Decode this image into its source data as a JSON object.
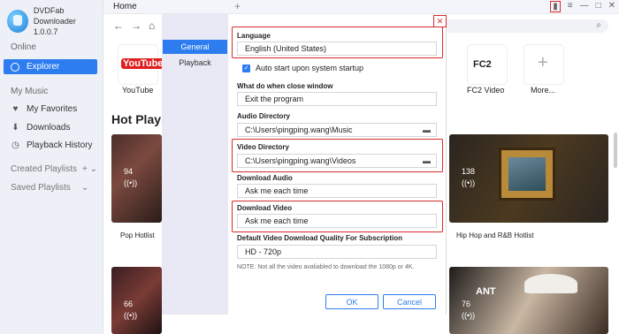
{
  "app": {
    "name": "DVDFab Downloader",
    "version": "1.0.0.7"
  },
  "sidebar": {
    "online_header": "Online",
    "explorer": "Explorer",
    "mymusic_header": "My Music",
    "items": [
      {
        "label": "My Favorites",
        "icon": "heart-icon"
      },
      {
        "label": "Downloads",
        "icon": "download-icon"
      },
      {
        "label": "Playback History",
        "icon": "history-icon"
      }
    ],
    "created_playlists": "Created Playlists",
    "saved_playlists": "Saved Playlists"
  },
  "tabs": {
    "home": "Home"
  },
  "sites": {
    "youtube_logo": "YouTube",
    "youtube": "YouTube",
    "fc2_logo": "FC2",
    "fc2": "FC2 Video",
    "more": "More..."
  },
  "hot_title": "Hot Playlis",
  "cards": [
    {
      "count": "94",
      "title": "Pop Hotlist"
    },
    {
      "count": "138",
      "title": "Hip Hop and R&B Hotlist"
    },
    {
      "count": "66"
    },
    {
      "count": "76",
      "overlay_text": "ANT"
    }
  ],
  "dialog": {
    "nav": {
      "general": "General",
      "playback": "Playback"
    },
    "language_label": "Language",
    "language_value": "English (United States)",
    "auto_start": "Auto start upon system startup",
    "close_label": "What do when close window",
    "close_value": "Exit the program",
    "audio_dir_label": "Audio Directory",
    "audio_dir_value": "C:\\Users\\pingping.wang\\Music",
    "video_dir_label": "Video Directory",
    "video_dir_value": "C:\\Users\\pingping.wang\\Videos",
    "download_audio_label": "Download Audio",
    "download_audio_value": "Ask me each time",
    "download_video_label": "Download Video",
    "download_video_value": "Ask me each time",
    "quality_label": "Default Video Download Quality For Subscription",
    "quality_value": "HD - 720p",
    "note": "NOTE: Not all the video avaliabled to download the 1080p or 4K.",
    "ok": "OK",
    "cancel": "Cancel"
  },
  "colors": {
    "accent": "#2d7df0",
    "highlight": "#d62b2b"
  }
}
